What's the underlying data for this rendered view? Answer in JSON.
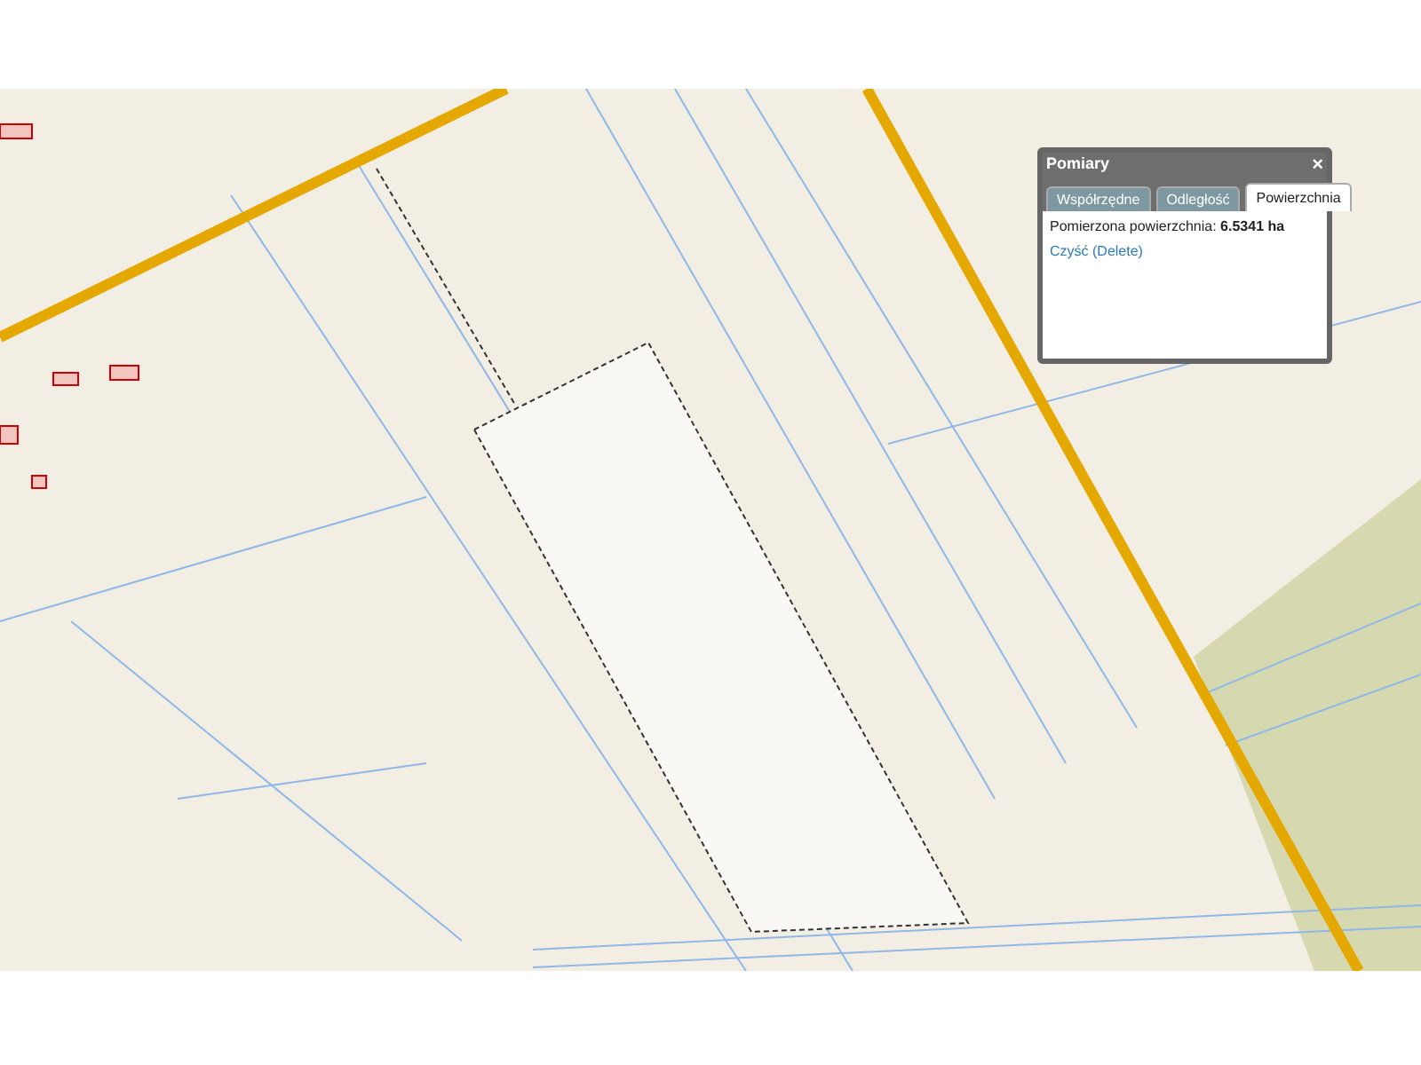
{
  "popup": {
    "title": "Pomiary",
    "close": "×",
    "tabs": [
      {
        "label": "Współrzędne",
        "selected": false
      },
      {
        "label": "Odległość",
        "selected": false
      },
      {
        "label": "Powierzchnia",
        "selected": true
      }
    ],
    "result": "Pomierzona powierzchnia: **6.5341 ha**",
    "clear_link": "Czyść (Delete)"
  }
}
